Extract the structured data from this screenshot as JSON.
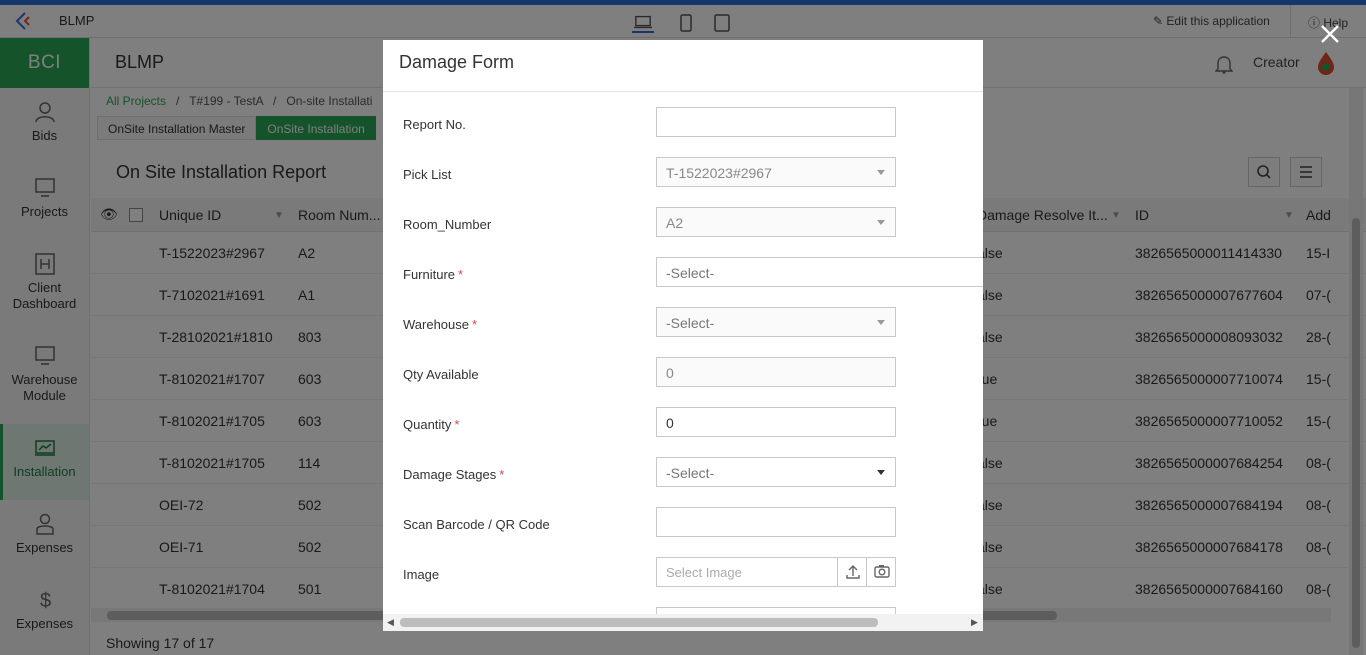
{
  "appbar": {
    "app_name": "BLMP",
    "edit_label": "Edit this application",
    "help_label": "Help"
  },
  "sidebar": {
    "brand": "BCI",
    "items": [
      {
        "label": "Bids",
        "icon": "user-icon"
      },
      {
        "label": "Projects",
        "icon": "monitor-icon"
      },
      {
        "label": "Client Dashboard",
        "icon": "h-box-icon"
      },
      {
        "label": "Warehouse Module",
        "icon": "monitor-icon"
      },
      {
        "label": "Installation",
        "icon": "chart-monitor-icon",
        "active": true
      },
      {
        "label": "Expenses",
        "icon": "person-badge-icon"
      },
      {
        "label": "Expenses",
        "icon": "dollar-icon"
      }
    ]
  },
  "header": {
    "title": "BLMP",
    "creator": "Creator"
  },
  "breadcrumb": {
    "root": "All Projects",
    "sep": "/",
    "project": "T#199 - TestA",
    "current": "On-site Installati"
  },
  "tabs": [
    "OnSite Installation Master",
    "OnSite Installation"
  ],
  "report": {
    "title": "On Site Installation Report",
    "columns": {
      "unique_id": "Unique ID",
      "room_num": "Room Num...",
      "damage_resolve": "Damage Resolve It...",
      "id": "ID",
      "add": "Add"
    },
    "rows": [
      {
        "uid": "T-1522023#2967",
        "room": "A2",
        "res": "alse",
        "id": "3826565000011414330",
        "add": "15-I"
      },
      {
        "uid": "T-7102021#1691",
        "room": "A1",
        "res": "alse",
        "id": "3826565000007677604",
        "add": "07-("
      },
      {
        "uid": "T-28102021#1810",
        "room": "803",
        "res": "alse",
        "id": "3826565000008093032",
        "add": "28-("
      },
      {
        "uid": "T-8102021#1707",
        "room": "603",
        "res": "rue",
        "id": "3826565000007710074",
        "add": "15-("
      },
      {
        "uid": "T-8102021#1705",
        "room": "603",
        "res": "rue",
        "id": "3826565000007710052",
        "add": "15-("
      },
      {
        "uid": "T-8102021#1705",
        "room": "114",
        "res": "alse",
        "id": "3826565000007684254",
        "add": "08-("
      },
      {
        "uid": "OEI-72",
        "room": "502",
        "res": "alse",
        "id": "3826565000007684194",
        "add": "08-("
      },
      {
        "uid": "OEI-71",
        "room": "502",
        "res": "alse",
        "id": "3826565000007684178",
        "add": "08-("
      },
      {
        "uid": "T-8102021#1704",
        "room": "501",
        "res": "alse",
        "id": "3826565000007684160",
        "add": "08-("
      }
    ],
    "showing": "Showing 17 of 17"
  },
  "modal": {
    "title": "Damage Form",
    "fields": {
      "report_no": {
        "label": "Report No.",
        "value": ""
      },
      "pick_list": {
        "label": "Pick List",
        "value": "T-1522023#2967"
      },
      "room_number": {
        "label": "Room_Number",
        "value": "A2"
      },
      "furniture": {
        "label": "Furniture",
        "value": "-Select-"
      },
      "warehouse": {
        "label": "Warehouse",
        "value": "-Select-"
      },
      "qty_available": {
        "label": "Qty Available",
        "value": "0"
      },
      "quantity": {
        "label": "Quantity",
        "value": "0"
      },
      "damage_stages": {
        "label": "Damage Stages",
        "value": "-Select-"
      },
      "scan": {
        "label": "Scan Barcode / QR Code",
        "value": ""
      },
      "image": {
        "label": "Image",
        "placeholder": "Select Image"
      }
    },
    "required_mark": "*"
  },
  "colors": {
    "brand_green": "#2aa657",
    "top_strip": "#2a6fd6",
    "required": "#e04848"
  }
}
